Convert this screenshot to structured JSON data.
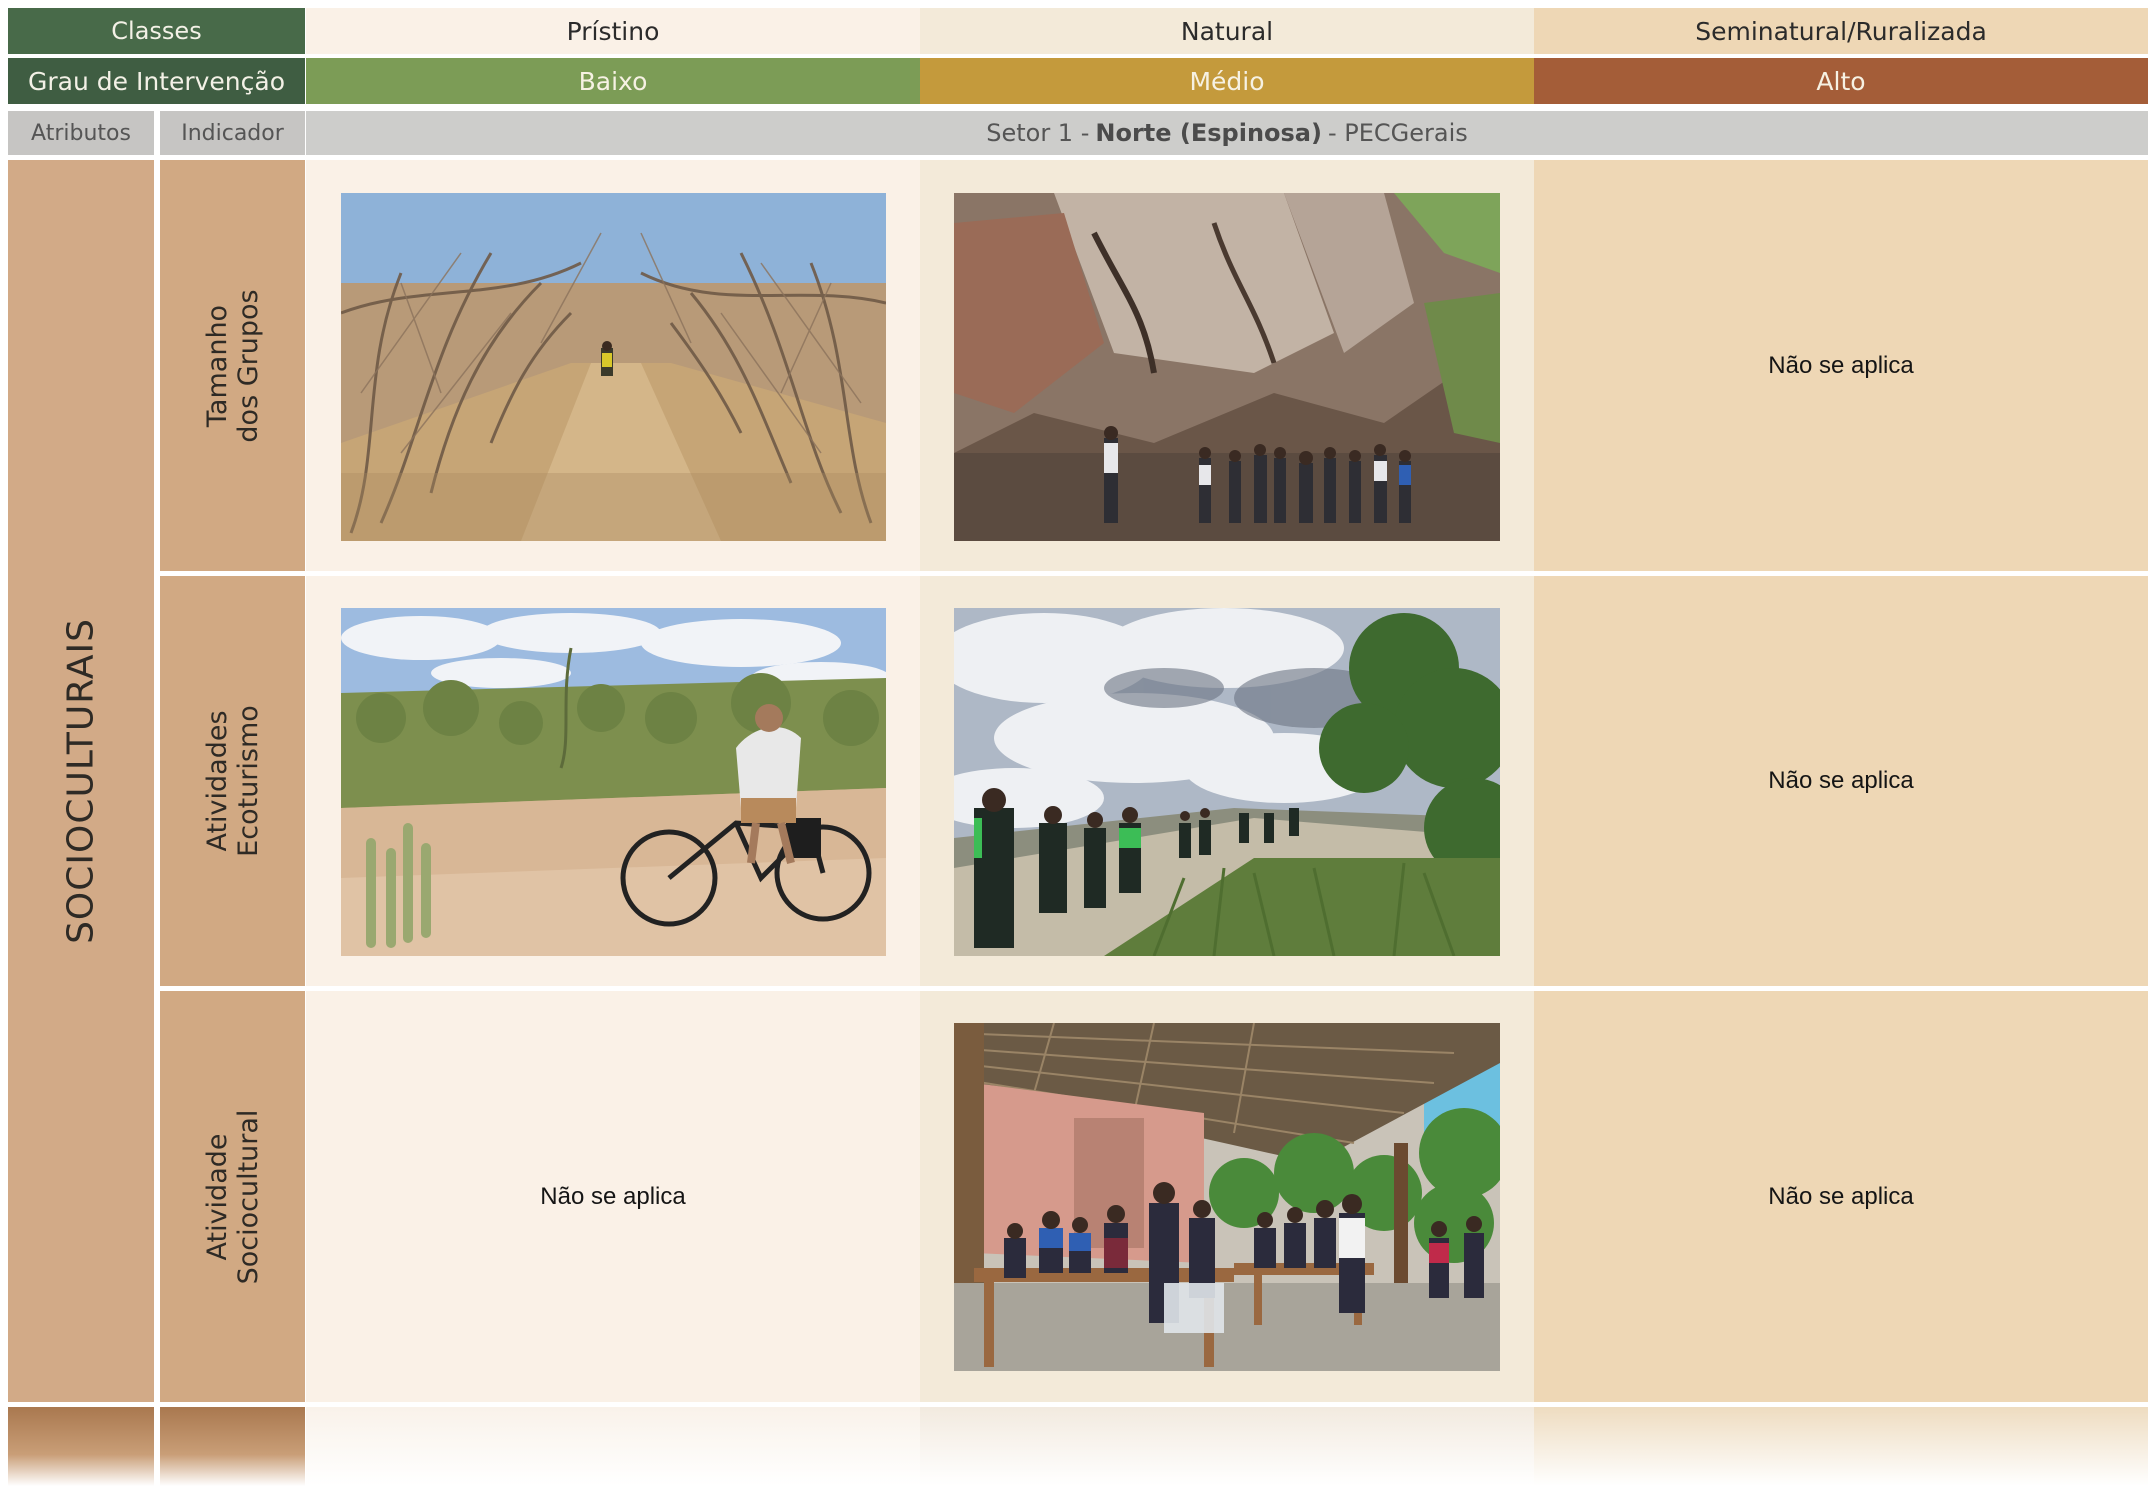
{
  "header": {
    "classes_label": "Classes",
    "grau_label": "Grau de Intervenção",
    "columns": [
      {
        "name": "Prístino",
        "level": "Baixo",
        "level_color": "#7c9c56"
      },
      {
        "name": "Natural",
        "level": "Médio",
        "level_color": "#c49a3c"
      },
      {
        "name": "Seminatural/Ruralizada",
        "level": "Alto",
        "level_color": "#a45d38"
      }
    ]
  },
  "subheader": {
    "atributos": "Atributos",
    "indicador": "Indicador",
    "sector_prefix": "Setor 1 -",
    "sector_name": "Norte (Espinosa)",
    "sector_suffix": "- PECGerais"
  },
  "attribute": "SOCIOCULTURAIS",
  "rows": [
    {
      "indicator": "Tamanho\ndos Grupos",
      "pristino": {
        "photo": "hiker-on-dry-forest-trail-photo"
      },
      "natural": {
        "photo": "group-under-rock-shelter-photo"
      },
      "seminatural": {
        "text": "Não se aplica"
      }
    },
    {
      "indicator": "Atividades\nEcoturismo",
      "pristino": {
        "photo": "cyclist-on-dirt-road-photo"
      },
      "natural": {
        "photo": "group-hiking-on-rock-outcrop-photo"
      },
      "seminatural": {
        "text": "Não se aplica"
      }
    },
    {
      "indicator": "Atividade\nSociocultural",
      "pristino": {
        "text": "Não se aplica"
      },
      "natural": {
        "photo": "people-dining-under-thatched-porch-photo"
      },
      "seminatural": {
        "text": "Não se aplica"
      }
    }
  ],
  "colors": {
    "header_green": "#486a49",
    "attribute_tan": "#d2aa87",
    "pristino_bg": "#faf1e7",
    "natural_bg": "#f3ead9",
    "seminatural_bg": "#eed7b5"
  }
}
